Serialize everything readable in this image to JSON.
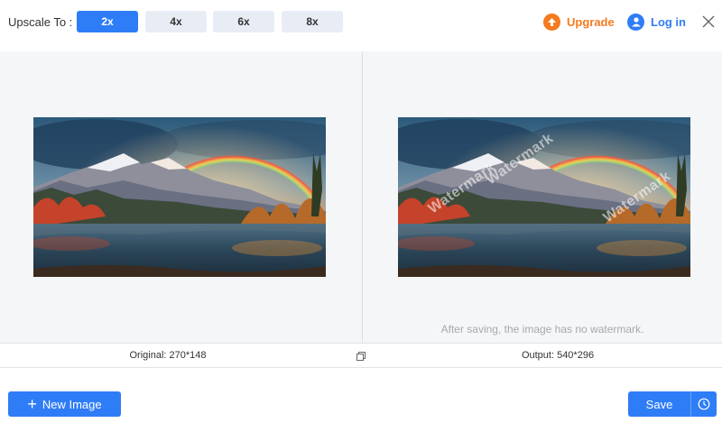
{
  "toolbar": {
    "upscale_label": "Upscale To :",
    "scales": [
      "2x",
      "4x",
      "6x",
      "8x"
    ],
    "selected_scale": "2x",
    "upgrade_label": "Upgrade",
    "login_label": "Log in",
    "icons": {
      "upgrade": "upgrade-arrow-icon",
      "login": "user-icon",
      "close": "close-icon"
    }
  },
  "preview": {
    "watermark_text": "Watermark",
    "watermark_note": "After saving, the image has no watermark."
  },
  "info": {
    "original": "Original: 270*148",
    "output": "Output: 540*296"
  },
  "footer": {
    "new_image_label": "New Image",
    "save_label": "Save"
  },
  "colors": {
    "accent": "#2f7df6",
    "upgrade": "#f47b20",
    "canvas_bg": "#f5f6f8"
  }
}
